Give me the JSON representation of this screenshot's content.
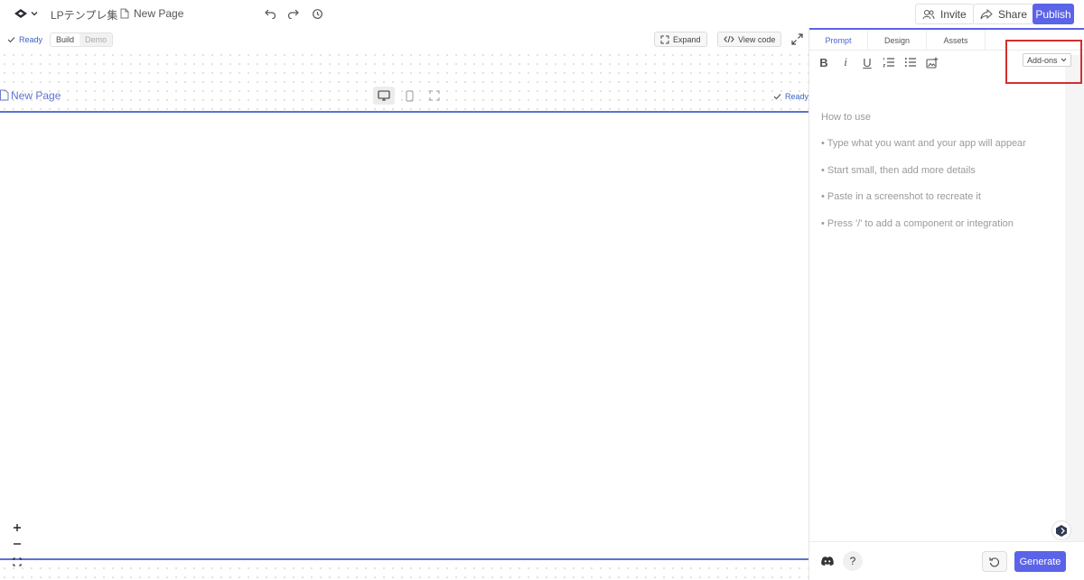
{
  "topbar": {
    "project_name": "LPテンプレ集",
    "separator": "/",
    "page_name": "New Page",
    "invite_label": "Invite",
    "share_label": "Share",
    "publish_label": "Publish"
  },
  "canvas": {
    "status_left": "Ready",
    "mode_build": "Build",
    "mode_demo": "Demo",
    "expand_label": "Expand",
    "view_code_label": "View code",
    "page_title": "New Page",
    "status_right": "Ready"
  },
  "panel": {
    "tabs": [
      "Prompt",
      "Design",
      "Assets"
    ],
    "addons_label": "Add-ons",
    "help_title": "How to use",
    "help_items": [
      "• Type what you want and your app will appear",
      "• Start small, then add more details",
      "• Paste in a screenshot to recreate it",
      "• Press '/' to add a component or integration"
    ],
    "generate_label": "Generate"
  },
  "colors": {
    "accent": "#5b63e8",
    "page_line": "#5c73cf",
    "highlight": "#d32f2f"
  }
}
